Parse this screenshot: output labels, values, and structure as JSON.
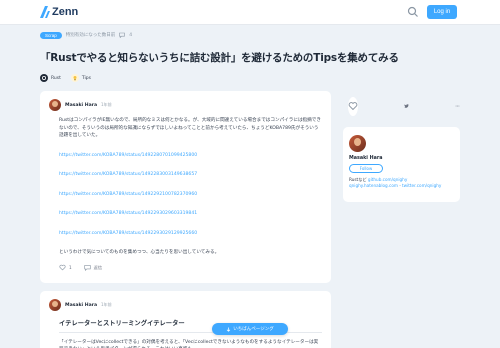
{
  "header": {
    "logo": "Zenn",
    "login_label": "Log in"
  },
  "article": {
    "badge": "Scrap",
    "meta_text": "特別有効になった数日前",
    "comment_count": "4",
    "title": "「Rustでやると知らないうちに詰む設計」を避けるためのTipsを集めてみる",
    "tags": [
      {
        "label": "Rust",
        "color": "#1f2937"
      },
      {
        "label": "Tips",
        "color": "#f6c543"
      }
    ]
  },
  "post1": {
    "author": "Masaki Hara",
    "date": "1年前",
    "paragraph": "RustはコンパイラがIE無いなので、局所的なミスは何とかなる。が、大域的に間違えている場合まではコンパイラには指摘できないので、そういうのは局所的な知識にならずでほしいよねってことと前から考えていたら、ちょうどKOBA789氏がそういう話題を出していた。",
    "links": [
      "https://twitter.com/KOBA789/status/1492280701099425800",
      "https://twitter.com/KOBA789/status/1492283003149638657",
      "https://twitter.com/KOBA789/status/1492292100782370960",
      "https://twitter.com/KOBA789/status/1492293029603319841",
      "https://twitter.com/KOBA789/status/1492293029129925660"
    ],
    "closing": "というわけで気についてのものを集めつつ、心当たりを思い出していてみる。",
    "like_count": "1",
    "reply_label": "返信"
  },
  "post2": {
    "author": "Masaki Hara",
    "date": "1年前",
    "heading": "イテレーターとストリーミングイテレーター",
    "paragraph1": "「イテレーターはVecにcollectできる」の対偶を考えると、「Vecにcollectできないようなものをするようなイテレーターは実装できない」という思考パターンが得られる。これはいい直感も。"
  },
  "sidebar": {
    "author": "Masaki Hara",
    "follow_label": "Follow",
    "bio_line1": "Rustなど",
    "bio_link1": "github.com/qnighy",
    "bio_line2": "qnighy.hatenablog.com",
    "bio_line3": "twitter.com/qnighy"
  },
  "toc_label": "いちばんページング",
  "colors": {
    "accent": "#3ea8ff",
    "background": "#edf2f7"
  }
}
